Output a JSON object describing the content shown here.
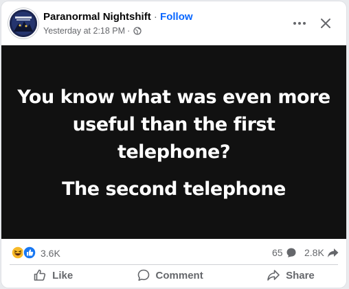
{
  "post": {
    "page_name": "Paranormal Nightshift",
    "separator": "·",
    "follow_label": "Follow",
    "timestamp": "Yesterday at 2:18 PM",
    "meta_separator": "·",
    "privacy_icon": "globe-icon",
    "more_icon": "more-horizontal-icon",
    "close_icon": "close-icon",
    "image_text": {
      "line1": "You know what was even more",
      "line2": "useful than the first",
      "line3": "telephone?",
      "line4": "The second telephone"
    }
  },
  "engagement": {
    "reaction_icons": [
      "haha-reaction-icon",
      "like-reaction-icon"
    ],
    "reaction_count": "3.6K",
    "comment_count": "65",
    "share_count": "2.8K"
  },
  "actions": {
    "like_label": "Like",
    "comment_label": "Comment",
    "share_label": "Share"
  },
  "colors": {
    "accent": "#0866ff",
    "image_background": "#111111",
    "secondary_text": "#65676b",
    "haha": "#f7b928"
  }
}
